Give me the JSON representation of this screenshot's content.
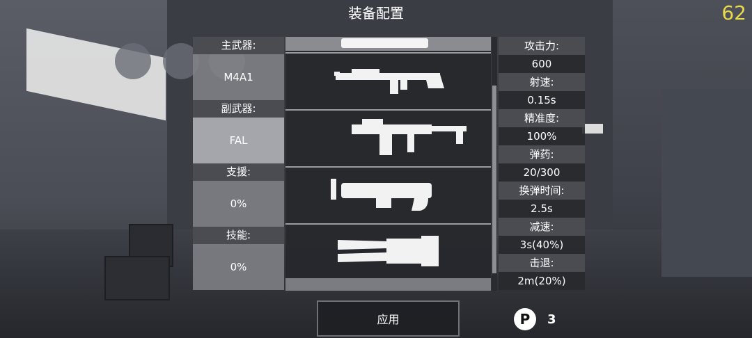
{
  "header": {
    "title": "装备配置",
    "fps": "62"
  },
  "loadout": [
    {
      "label": "主武器:",
      "value": "M4A1",
      "selected": false
    },
    {
      "label": "副武器:",
      "value": "FAL",
      "selected": true
    },
    {
      "label": "支援:",
      "value": "0%",
      "selected": false
    },
    {
      "label": "技能:",
      "value": "0%",
      "selected": false
    }
  ],
  "weapons": [
    {
      "icon": "rifle-icon"
    },
    {
      "icon": "smg-icon"
    },
    {
      "icon": "launcher-icon"
    },
    {
      "icon": "melee-blade-icon"
    }
  ],
  "stats": [
    {
      "label": "攻击力:",
      "value": "600"
    },
    {
      "label": "射速:",
      "value": "0.15s"
    },
    {
      "label": "精准度:",
      "value": "100%"
    },
    {
      "label": "弹药:",
      "value": "20/300"
    },
    {
      "label": "换弹时间:",
      "value": "2.5s"
    },
    {
      "label": "减速:",
      "value": "3s(40%)"
    },
    {
      "label": "击退:",
      "value": "2m(20%)"
    }
  ],
  "footer": {
    "apply_label": "应用",
    "points_icon": "P",
    "points_value": "3"
  },
  "colors": {
    "fps": "#e8d94a",
    "panel": "#4a4c52"
  }
}
